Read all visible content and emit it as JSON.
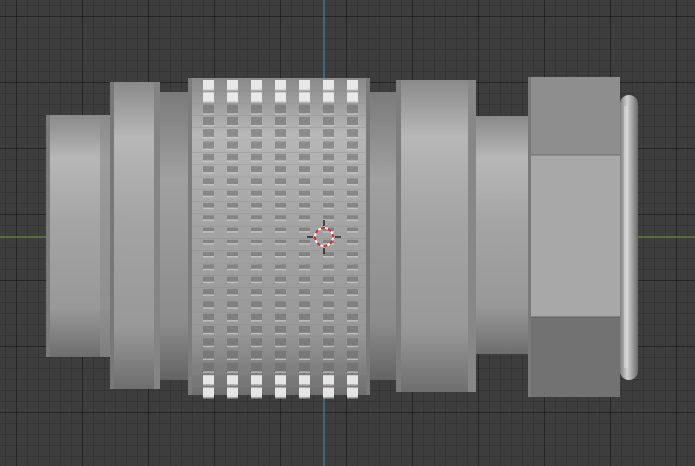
{
  "viewport": {
    "background": "#3d3d3d",
    "grid_color": "#2e2e2e",
    "x_axis_color": "#7f9d43",
    "y_axis_color": "#3d86b4"
  },
  "model": {
    "name": "",
    "body_color": "#9e9e9e",
    "highlight_color": "#c4c4c4",
    "shadow_color": "#6a6a6a"
  },
  "icons": {
    "cursor": "3d-cursor-icon"
  }
}
